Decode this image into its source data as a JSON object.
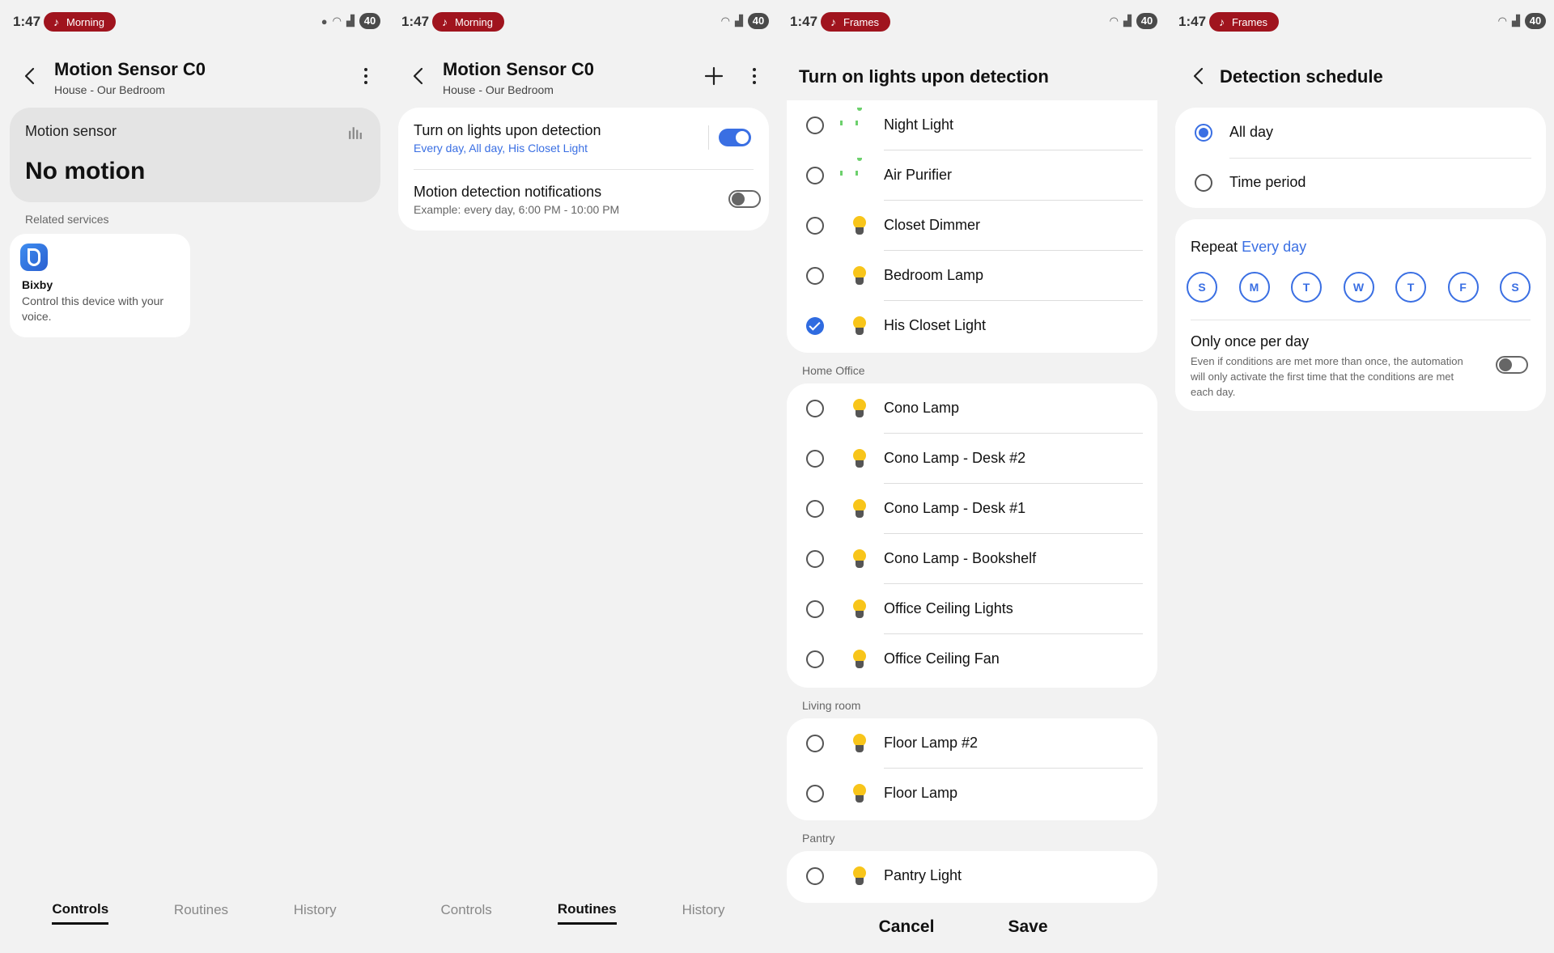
{
  "status": {
    "time": "1:47",
    "p1_pill": "Morning",
    "p2_pill": "Morning",
    "p3_pill": "Frames",
    "p4_pill": "Frames",
    "battery": "40"
  },
  "device": {
    "title": "Motion Sensor C0",
    "subtitle": "House - Our Bedroom"
  },
  "controls": {
    "sensor_label": "Motion sensor",
    "sensor_state": "No motion",
    "related_label": "Related services",
    "bixby_name": "Bixby",
    "bixby_desc": "Control this device with your voice."
  },
  "routines": {
    "lights_title": "Turn on lights upon detection",
    "lights_sub": "Every day, All day, His Closet Light",
    "lights_on": true,
    "notif_title": "Motion detection notifications",
    "notif_sub": "Example: every day, 6:00 PM - 10:00 PM",
    "notif_on": false
  },
  "tabs": {
    "controls": "Controls",
    "routines": "Routines",
    "history": "History"
  },
  "picker": {
    "title": "Turn on lights upon detection",
    "group1": [
      {
        "name": "Night Light",
        "icon": "plug-icon",
        "checked": false
      },
      {
        "name": "Air Purifier",
        "icon": "plug-icon",
        "checked": false
      },
      {
        "name": "Closet Dimmer",
        "icon": "bulb-icon",
        "checked": false
      },
      {
        "name": "Bedroom Lamp",
        "icon": "bulb-icon",
        "checked": false
      },
      {
        "name": "His Closet Light",
        "icon": "bulb-icon",
        "checked": true
      }
    ],
    "home_office_label": "Home Office",
    "home_office": [
      {
        "name": "Cono Lamp",
        "icon": "bulb-icon",
        "checked": false
      },
      {
        "name": "Cono Lamp - Desk #2",
        "icon": "bulb-icon",
        "checked": false
      },
      {
        "name": "Cono Lamp - Desk #1",
        "icon": "bulb-icon",
        "checked": false
      },
      {
        "name": "Cono Lamp - Bookshelf",
        "icon": "bulb-icon",
        "checked": false
      },
      {
        "name": "Office Ceiling Lights",
        "icon": "bulb-icon",
        "checked": false
      },
      {
        "name": "Office Ceiling Fan",
        "icon": "bulb-icon",
        "checked": false
      }
    ],
    "living_label": "Living room",
    "living": [
      {
        "name": "Floor Lamp #2",
        "icon": "bulb-icon",
        "checked": false
      },
      {
        "name": "Floor Lamp",
        "icon": "bulb-icon",
        "checked": false
      }
    ],
    "pantry_label": "Pantry",
    "pantry": [
      {
        "name": "Pantry Light",
        "icon": "bulb-icon",
        "checked": false
      }
    ],
    "cancel": "Cancel",
    "save": "Save"
  },
  "schedule": {
    "title": "Detection schedule",
    "all_day": "All day",
    "time_period": "Time period",
    "selected": "All day",
    "repeat_label": "Repeat",
    "repeat_value": "Every day",
    "days": [
      "S",
      "M",
      "T",
      "W",
      "T",
      "F",
      "S"
    ],
    "once_title": "Only once per day",
    "once_desc": "Even if conditions are met more than once, the automation will only activate the first time that the conditions are met each day.",
    "once_on": false
  },
  "colors": {
    "accent": "#3a6fe3",
    "pill": "#a0141e",
    "bulb": "#f8c51a"
  }
}
